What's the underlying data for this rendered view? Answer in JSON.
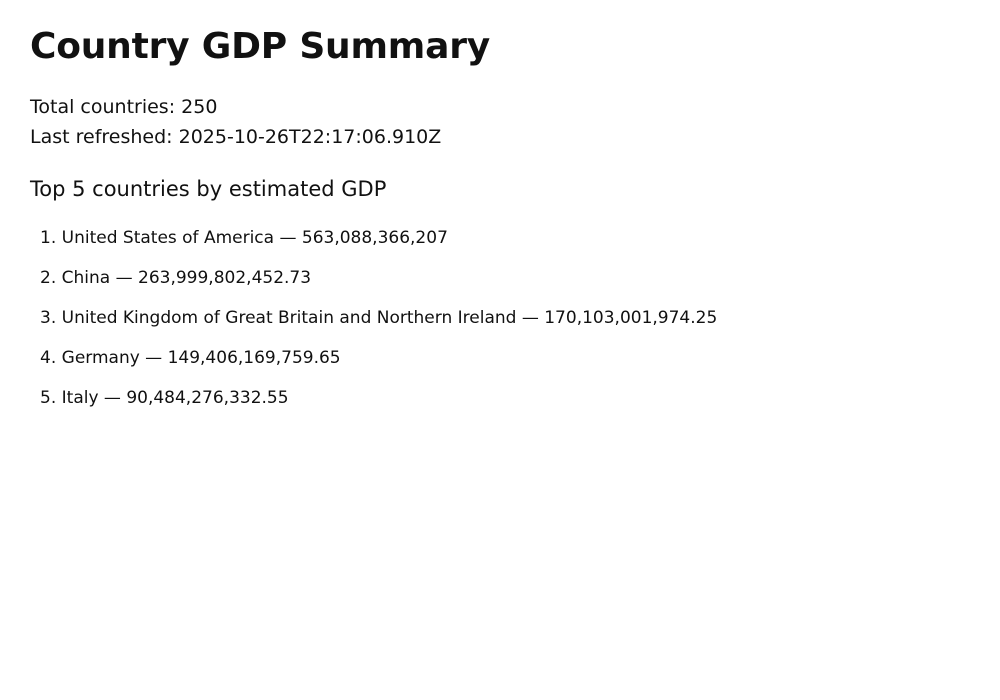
{
  "page": {
    "title": "Country GDP Summary",
    "total_countries": "Total countries: 250",
    "last_refreshed": "Last refreshed: 2025-10-26T22:17:06.910Z",
    "section_heading": "Top 5 countries by estimated GDP"
  },
  "top_countries": [
    {
      "rank": "1.",
      "text": "United States of America — 563,088,366,207"
    },
    {
      "rank": "2.",
      "text": "China — 263,999,802,452.73"
    },
    {
      "rank": "3.",
      "text": "United Kingdom of Great Britain and Northern Ireland — 170,103,001,974.25"
    },
    {
      "rank": "4.",
      "text": "Germany — 149,406,169,759.65"
    },
    {
      "rank": "5.",
      "text": "Italy — 90,484,276,332.55"
    }
  ]
}
